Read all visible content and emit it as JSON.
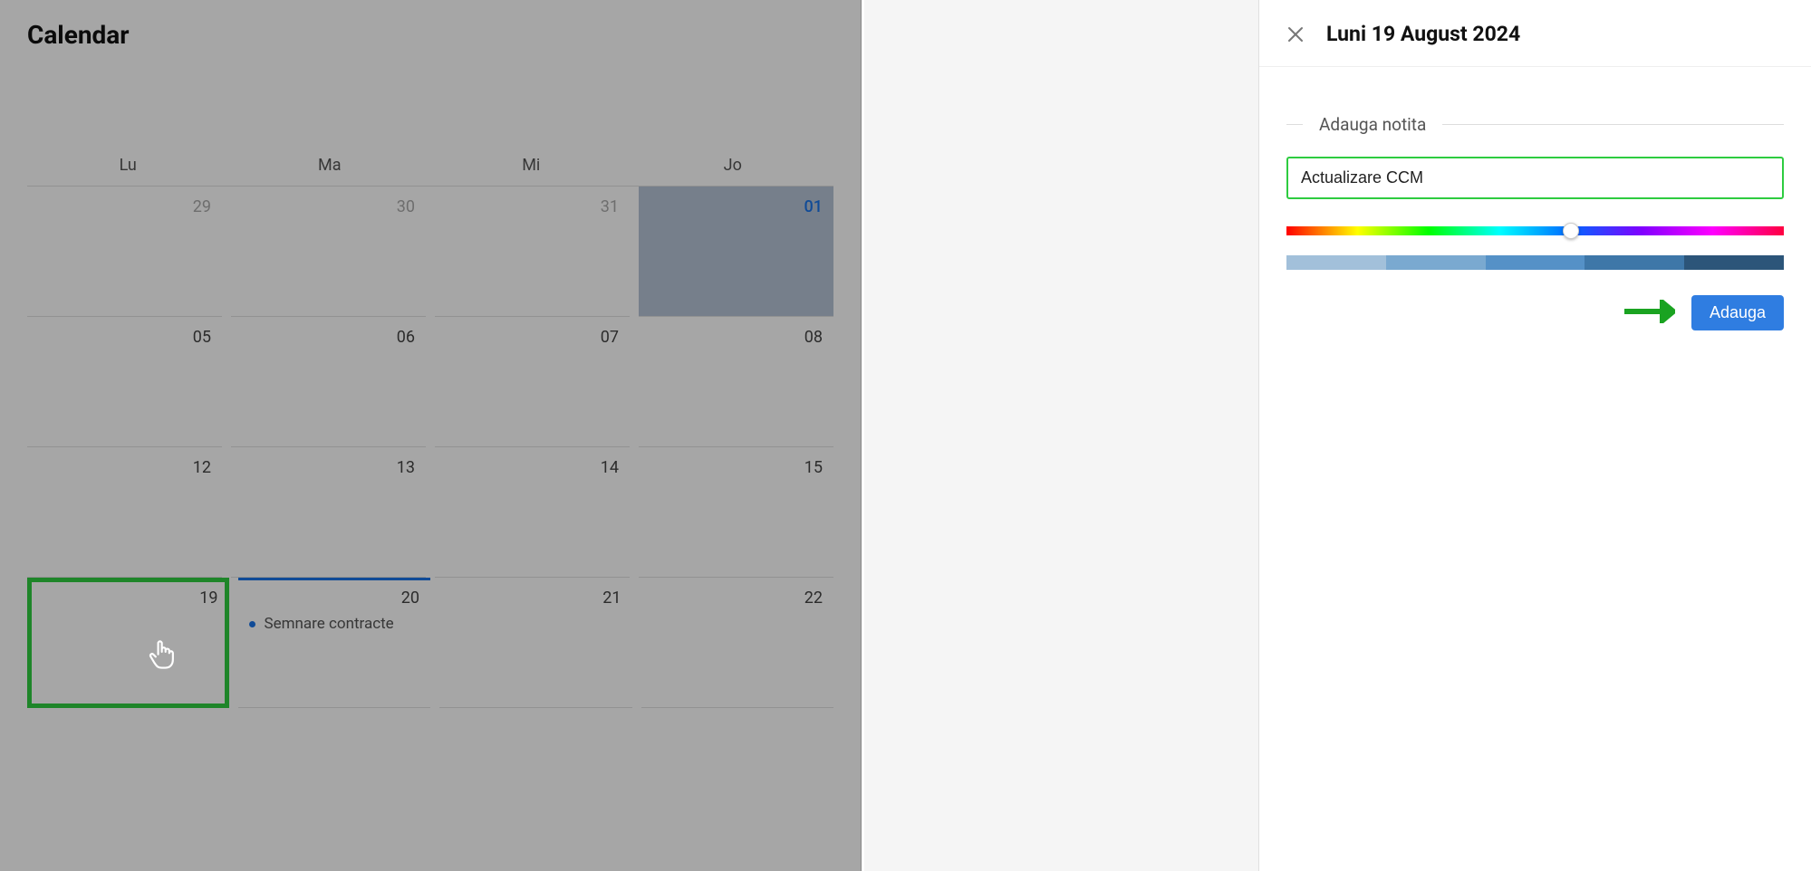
{
  "page": {
    "title": "Calendar"
  },
  "day_headers": [
    "Lu",
    "Ma",
    "Mi",
    "Jo"
  ],
  "weeks": [
    {
      "days": [
        {
          "num": "29",
          "muted": true
        },
        {
          "num": "30",
          "muted": true
        },
        {
          "num": "31",
          "muted": true
        },
        {
          "num": "01",
          "active": true,
          "selected": true
        }
      ]
    },
    {
      "days": [
        {
          "num": "05"
        },
        {
          "num": "06"
        },
        {
          "num": "07"
        },
        {
          "num": "08"
        }
      ]
    },
    {
      "days": [
        {
          "num": "12"
        },
        {
          "num": "13"
        },
        {
          "num": "14"
        },
        {
          "num": "15"
        }
      ]
    },
    {
      "days": [
        {
          "num": "19",
          "highlighted": true
        },
        {
          "num": "20",
          "has_event": true,
          "event_label": "Semnare contracte"
        },
        {
          "num": "21"
        },
        {
          "num": "22"
        }
      ]
    }
  ],
  "panel": {
    "date_title": "Luni 19 August 2024",
    "section_label": "Adauga notita",
    "input_value": "Actualizare CCM",
    "add_button": "Adauga",
    "shades": [
      "#a2c0da",
      "#7aa9d0",
      "#5591c7",
      "#3e77a8",
      "#2c5579"
    ]
  }
}
